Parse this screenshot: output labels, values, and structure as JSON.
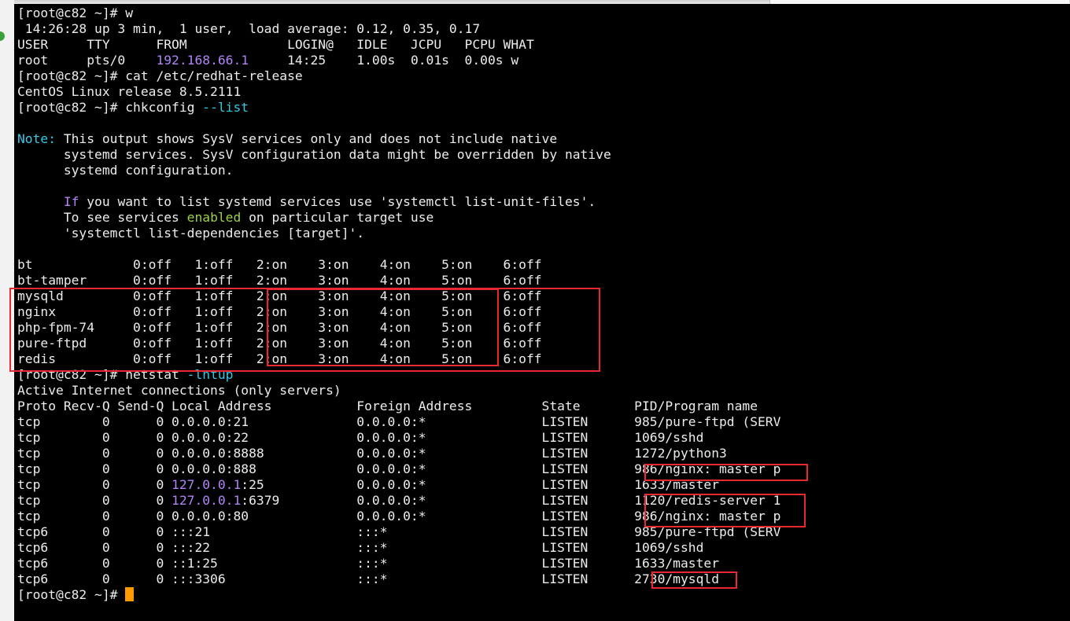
{
  "terminal": {
    "lines": [
      {
        "segs": [
          {
            "t": "[root@c82 ~]# w"
          }
        ]
      },
      {
        "segs": [
          {
            "t": " 14:26:28 up 3 min,  1 user,  load average: 0.12, 0.35, 0.17"
          }
        ]
      },
      {
        "segs": [
          {
            "t": "USER     TTY      FROM             LOGIN@   IDLE   JCPU   PCPU WHAT"
          }
        ]
      },
      {
        "segs": [
          {
            "t": "root     pts/0    "
          },
          {
            "t": "192.168.66.1",
            "c": "ip"
          },
          {
            "t": "     14:25    1.00s  0.01s  0.00s w"
          }
        ]
      },
      {
        "segs": [
          {
            "t": "[root@c82 ~]# cat /etc/redhat-release"
          }
        ]
      },
      {
        "segs": [
          {
            "t": "CentOS Linux release 8.5.2111"
          }
        ]
      },
      {
        "segs": [
          {
            "t": "[root@c82 ~]# chkconfig "
          },
          {
            "t": "--list",
            "c": "cyan"
          }
        ]
      },
      {
        "segs": [
          {
            "t": ""
          }
        ]
      },
      {
        "segs": [
          {
            "t": "Note:",
            "c": "cyan"
          },
          {
            "t": " This output shows SysV services only and does not include native"
          }
        ]
      },
      {
        "segs": [
          {
            "t": "      systemd services. SysV configuration data might be overridden by native"
          }
        ]
      },
      {
        "segs": [
          {
            "t": "      systemd configuration."
          }
        ]
      },
      {
        "segs": [
          {
            "t": ""
          }
        ]
      },
      {
        "segs": [
          {
            "t": "      "
          },
          {
            "t": "If",
            "c": "purple"
          },
          {
            "t": " you want to list systemd services use 'systemctl list-unit-files'."
          }
        ]
      },
      {
        "segs": [
          {
            "t": "      To see services "
          },
          {
            "t": "enabled",
            "c": "green"
          },
          {
            "t": " on particular target use"
          }
        ]
      },
      {
        "segs": [
          {
            "t": "      'systemctl list-dependencies [target]'."
          }
        ]
      },
      {
        "segs": [
          {
            "t": ""
          }
        ]
      },
      {
        "segs": [
          {
            "t": "bt             0:off   1:off   2:on    3:on    4:on    5:on    6:off"
          }
        ]
      },
      {
        "segs": [
          {
            "t": "bt-tamper      0:off   1:off   2:on    3:on    4:on    5:on    6:off"
          }
        ]
      },
      {
        "segs": [
          {
            "t": "mysqld         0:off   1:off   2:on    3:on    4:on    5:on    6:off"
          }
        ]
      },
      {
        "segs": [
          {
            "t": "nginx          0:off   1:off   2:on    3:on    4:on    5:on    6:off"
          }
        ]
      },
      {
        "segs": [
          {
            "t": "php-fpm-74     0:off   1:off   2:on    3:on    4:on    5:on    6:off"
          }
        ]
      },
      {
        "segs": [
          {
            "t": "pure-ftpd      0:off   1:off   2:on    3:on    4:on    5:on    6:off"
          }
        ]
      },
      {
        "segs": [
          {
            "t": "redis          0:off   1:off   2:on    3:on    4:on    5:on    6:off"
          }
        ]
      },
      {
        "segs": [
          {
            "t": "[root@c82 ~]# netstat "
          },
          {
            "t": "-lntup",
            "c": "cyan"
          }
        ]
      },
      {
        "segs": [
          {
            "t": "Active Internet connections (only servers)"
          }
        ]
      },
      {
        "segs": [
          {
            "t": "Proto Recv-Q Send-Q Local Address           Foreign Address         State       PID/Program name"
          }
        ]
      },
      {
        "segs": [
          {
            "t": "tcp        0      0 0.0.0.0:21              0.0.0.0:*               LISTEN      985/pure-ftpd (SERV"
          }
        ]
      },
      {
        "segs": [
          {
            "t": "tcp        0      0 0.0.0.0:22              0.0.0.0:*               LISTEN      1069/sshd"
          }
        ]
      },
      {
        "segs": [
          {
            "t": "tcp        0      0 0.0.0.0:8888            0.0.0.0:*               LISTEN      1272/python3"
          }
        ]
      },
      {
        "segs": [
          {
            "t": "tcp        0      0 0.0.0.0:888             0.0.0.0:*               LISTEN      986/nginx: master p"
          }
        ]
      },
      {
        "segs": [
          {
            "t": "tcp        0      0 "
          },
          {
            "t": "127.0.0.1",
            "c": "ip"
          },
          {
            "t": ":25            0.0.0.0:*               LISTEN      1633/master"
          }
        ]
      },
      {
        "segs": [
          {
            "t": "tcp        0      0 "
          },
          {
            "t": "127.0.0.1",
            "c": "ip"
          },
          {
            "t": ":6379          0.0.0.0:*               LISTEN      1120/redis-server 1"
          }
        ]
      },
      {
        "segs": [
          {
            "t": "tcp        0      0 0.0.0.0:80              0.0.0.0:*               LISTEN      986/nginx: master p"
          }
        ]
      },
      {
        "segs": [
          {
            "t": "tcp6       0      0 :::21                   :::*                    LISTEN      985/pure-ftpd (SERV"
          }
        ]
      },
      {
        "segs": [
          {
            "t": "tcp6       0      0 :::22                   :::*                    LISTEN      1069/sshd"
          }
        ]
      },
      {
        "segs": [
          {
            "t": "tcp6       0      0 ::1:25                  :::*                    LISTEN      1633/master"
          }
        ]
      },
      {
        "segs": [
          {
            "t": "tcp6       0      0 :::3306                 :::*                    LISTEN      2730/mysqld"
          }
        ]
      },
      {
        "segs": [
          {
            "t": "[root@c82 ~]# "
          }
        ],
        "cursor": true
      }
    ],
    "colors": {
      "background": "#000000",
      "foreground": "#ececec",
      "ip": "#b084f7",
      "option": "#35c8e6",
      "keyword": "#b084f7",
      "enabled": "#9bd04b",
      "cursor": "#ff9a00",
      "annotation": "#e8292f"
    }
  }
}
